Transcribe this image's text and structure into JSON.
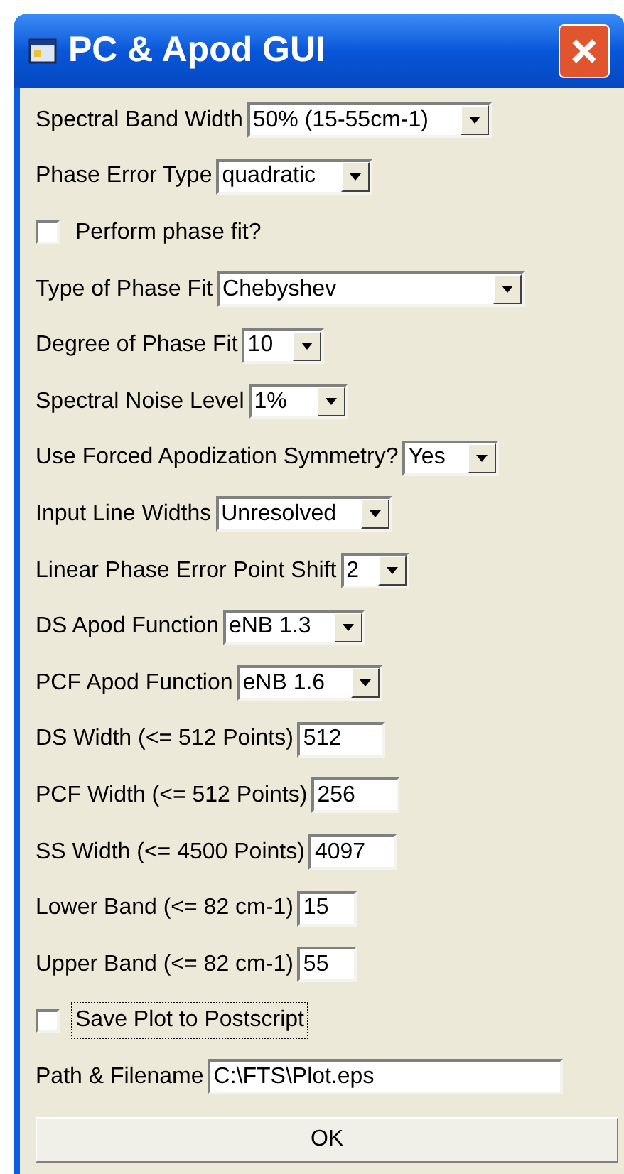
{
  "window": {
    "title": "PC & Apod GUI"
  },
  "fields": [
    {
      "kind": "select",
      "label": "Spectral Band Width",
      "value": "50% (15-55cm-1)"
    },
    {
      "kind": "select",
      "label": "Phase Error Type",
      "value": "quadratic"
    },
    {
      "kind": "checkbox",
      "label": "Perform phase fit?",
      "checked": false,
      "focused": false
    },
    {
      "kind": "select",
      "label": "Type of Phase Fit",
      "value": "Chebyshev"
    },
    {
      "kind": "select",
      "label": "Degree of Phase Fit",
      "value": "10"
    },
    {
      "kind": "select",
      "label": "Spectral Noise Level",
      "value": "1%"
    },
    {
      "kind": "select",
      "label": "Use Forced Apodization Symmetry?",
      "value": "Yes"
    },
    {
      "kind": "select",
      "label": "Input Line Widths",
      "value": "Unresolved"
    },
    {
      "kind": "select",
      "label": "Linear Phase Error Point Shift",
      "value": "2"
    },
    {
      "kind": "select",
      "label": "DS Apod Function",
      "value": "eNB 1.3"
    },
    {
      "kind": "select",
      "label": "PCF Apod Function",
      "value": "eNB 1.6"
    },
    {
      "kind": "text",
      "label": "DS Width (<= 512 Points)",
      "value": "512"
    },
    {
      "kind": "text",
      "label": "PCF Width (<= 512 Points)",
      "value": "256"
    },
    {
      "kind": "text",
      "label": "SS Width (<= 4500 Points)",
      "value": "4097"
    },
    {
      "kind": "text",
      "label": "Lower Band (<= 82 cm-1)",
      "value": "15"
    },
    {
      "kind": "text",
      "label": "Upper Band (<= 82 cm-1)",
      "value": "55"
    },
    {
      "kind": "checkbox",
      "label": "Save Plot to Postscript",
      "checked": false,
      "focused": true
    },
    {
      "kind": "text",
      "label": "Path & Filename",
      "value": "C:\\FTS\\Plot.eps"
    }
  ],
  "ok_button": "OK"
}
